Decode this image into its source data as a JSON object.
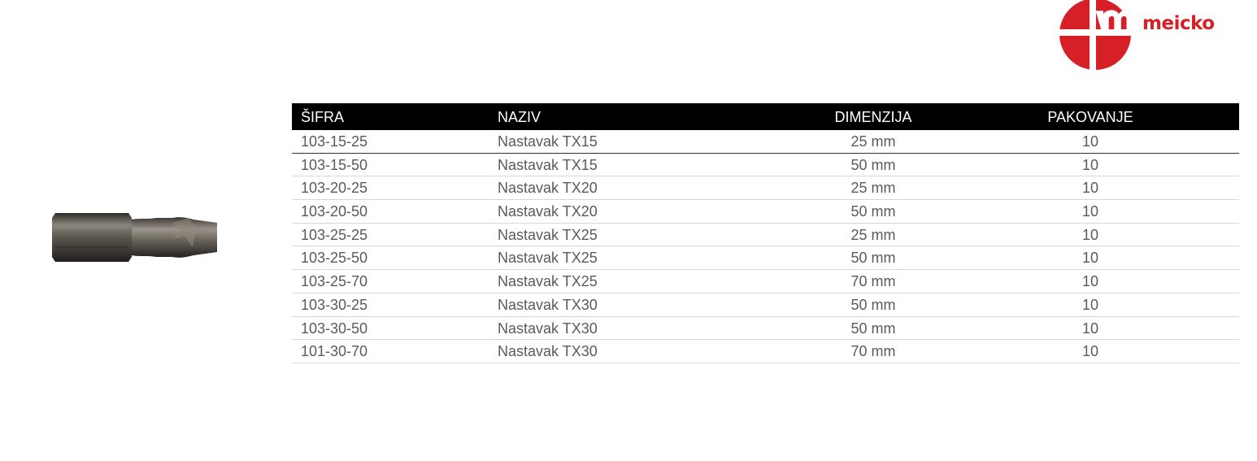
{
  "brand": {
    "name": "meicko",
    "color": "#d61f26"
  },
  "product_image": {
    "icon": "torx-bit-icon"
  },
  "table": {
    "headers": [
      "ŠIFRA",
      "NAZIV",
      "DIMENZIJA",
      "PAKOVANJE"
    ],
    "rows": [
      [
        "103-15-25",
        "Nastavak TX15",
        "25 mm",
        "10"
      ],
      [
        "103-15-50",
        "Nastavak TX15",
        "50 mm",
        "10"
      ],
      [
        "103-20-25",
        "Nastavak TX20",
        "25 mm",
        "10"
      ],
      [
        "103-20-50",
        "Nastavak TX20",
        "50 mm",
        "10"
      ],
      [
        "103-25-25",
        "Nastavak TX25",
        "25 mm",
        "10"
      ],
      [
        "103-25-50",
        "Nastavak TX25",
        "50 mm",
        "10"
      ],
      [
        "103-25-70",
        "Nastavak TX25",
        "70 mm",
        "10"
      ],
      [
        "103-30-25",
        "Nastavak TX30",
        "50 mm",
        "10"
      ],
      [
        "103-30-50",
        "Nastavak TX30",
        "50 mm",
        "10"
      ],
      [
        "101-30-70",
        "Nastavak TX30",
        "70 mm",
        "10"
      ]
    ]
  }
}
